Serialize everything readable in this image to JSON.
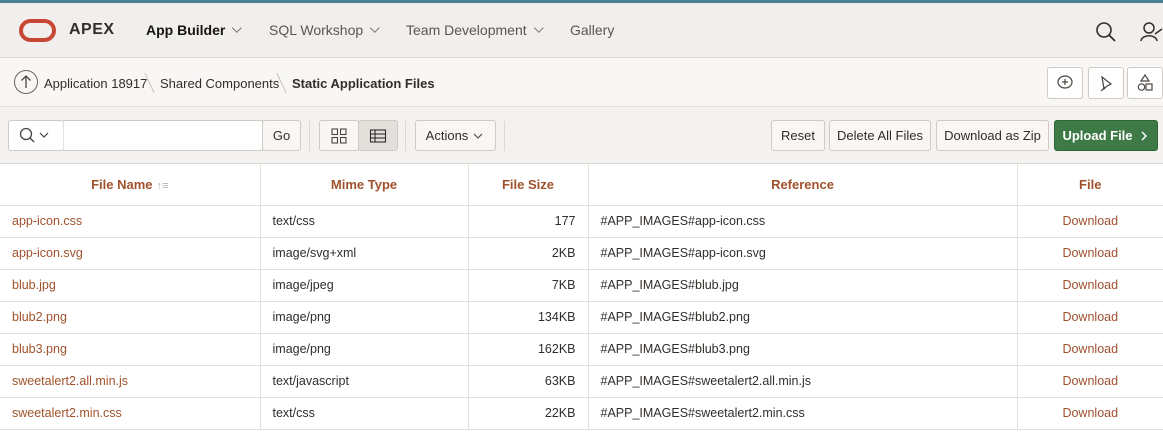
{
  "app": {
    "brand": "APEX"
  },
  "nav": {
    "items": [
      {
        "label": "App Builder"
      },
      {
        "label": "SQL Workshop"
      },
      {
        "label": "Team Development"
      },
      {
        "label": "Gallery"
      }
    ]
  },
  "breadcrumb": {
    "items": [
      {
        "label": "Application 18917"
      },
      {
        "label": "Shared Components"
      },
      {
        "label": "Static Application Files"
      }
    ]
  },
  "toolbar": {
    "search_value": "",
    "go_label": "Go",
    "actions_label": "Actions",
    "reset_label": "Reset",
    "delete_all_label": "Delete All Files",
    "download_zip_label": "Download as Zip",
    "upload_label": "Upload File"
  },
  "table": {
    "columns": [
      "File Name",
      "Mime Type",
      "File Size",
      "Reference",
      "File"
    ],
    "rows": [
      {
        "name": "app-icon.css",
        "mime": "text/css",
        "size": "177",
        "ref": "#APP_IMAGES#app-icon.css",
        "file": "Download"
      },
      {
        "name": "app-icon.svg",
        "mime": "image/svg+xml",
        "size": "2KB",
        "ref": "#APP_IMAGES#app-icon.svg",
        "file": "Download"
      },
      {
        "name": "blub.jpg",
        "mime": "image/jpeg",
        "size": "7KB",
        "ref": "#APP_IMAGES#blub.jpg",
        "file": "Download"
      },
      {
        "name": "blub2.png",
        "mime": "image/png",
        "size": "134KB",
        "ref": "#APP_IMAGES#blub2.png",
        "file": "Download"
      },
      {
        "name": "blub3.png",
        "mime": "image/png",
        "size": "162KB",
        "ref": "#APP_IMAGES#blub3.png",
        "file": "Download"
      },
      {
        "name": "sweetalert2.all.min.js",
        "mime": "text/javascript",
        "size": "63KB",
        "ref": "#APP_IMAGES#sweetalert2.all.min.js",
        "file": "Download"
      },
      {
        "name": "sweetalert2.min.css",
        "mime": "text/css",
        "size": "22KB",
        "ref": "#APP_IMAGES#sweetalert2.min.css",
        "file": "Download"
      }
    ]
  },
  "colors": {
    "accent_link": "#a0522d",
    "primary_button": "#3e7a46",
    "logo_red": "#c74634"
  },
  "icons": [
    "search-icon",
    "user-icon",
    "up-arrow-icon",
    "comment-icon",
    "pin-icon",
    "shapes-icon",
    "grid-view-icon",
    "report-view-icon",
    "sort-ascending-icon",
    "chevron-right-icon"
  ]
}
